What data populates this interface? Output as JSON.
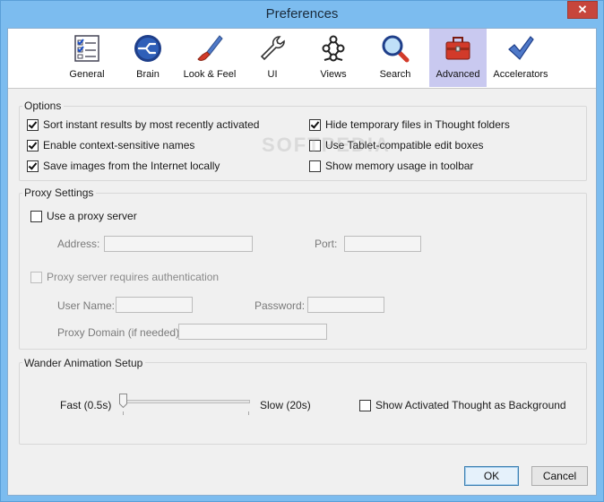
{
  "window": {
    "title": "Preferences",
    "close": "✕"
  },
  "toolbar": {
    "items": [
      {
        "label": "General",
        "icon": "checklist-icon"
      },
      {
        "label": "Brain",
        "icon": "brain-icon"
      },
      {
        "label": "Look & Feel",
        "icon": "paintbrush-icon"
      },
      {
        "label": "UI",
        "icon": "wrench-icon"
      },
      {
        "label": "Views",
        "icon": "views-icon"
      },
      {
        "label": "Search",
        "icon": "magnifier-icon"
      },
      {
        "label": "Advanced",
        "icon": "toolbox-icon",
        "active": true
      },
      {
        "label": "Accelerators",
        "icon": "checkmark-icon"
      }
    ]
  },
  "options": {
    "title": "Options",
    "items": [
      {
        "label": "Sort instant results by most recently activated",
        "checked": true
      },
      {
        "label": "Enable context-sensitive names",
        "checked": true
      },
      {
        "label": "Save images from the Internet locally",
        "checked": true
      },
      {
        "label": "Hide temporary files in Thought folders",
        "checked": true
      },
      {
        "label": "Use Tablet-compatible edit boxes",
        "checked": false
      },
      {
        "label": "Show memory usage in toolbar",
        "checked": false
      }
    ]
  },
  "proxy": {
    "title": "Proxy Settings",
    "use_proxy": "Use a proxy server",
    "address_label": "Address:",
    "address_value": "",
    "port_label": "Port:",
    "port_value": "",
    "requires_auth": "Proxy server requires authentication",
    "username_label": "User Name:",
    "username_value": "",
    "password_label": "Password:",
    "password_value": "",
    "domain_label": "Proxy Domain (if needed):",
    "domain_value": ""
  },
  "wander": {
    "title": "Wander Animation Setup",
    "fast_label": "Fast (0.5s)",
    "slow_label": "Slow (20s)",
    "slider_level": 0,
    "show_background": "Show Activated Thought as Background",
    "show_background_checked": false
  },
  "buttons": {
    "ok": "OK",
    "cancel": "Cancel"
  },
  "watermark": "SOFTPEDIA"
}
